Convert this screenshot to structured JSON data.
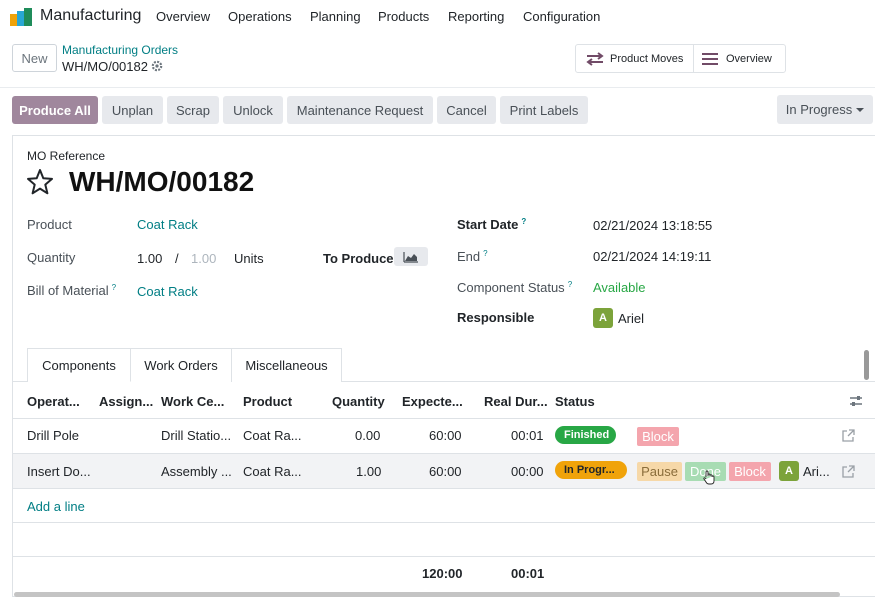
{
  "app": {
    "name": "Manufacturing",
    "menu": [
      "Overview",
      "Operations",
      "Planning",
      "Products",
      "Reporting",
      "Configuration"
    ]
  },
  "control": {
    "new_label": "New",
    "breadcrumb_parent": "Manufacturing Orders",
    "breadcrumb_current": "WH/MO/00182",
    "smart_buttons": [
      "Product Moves",
      "Overview"
    ]
  },
  "statusbar": {
    "buttons": [
      "Produce All",
      "Unplan",
      "Scrap",
      "Unlock",
      "Maintenance Request",
      "Cancel",
      "Print Labels"
    ],
    "state": "In Progress"
  },
  "form": {
    "reference_label": "MO Reference",
    "reference": "WH/MO/00182",
    "left_fields": {
      "product_label": "Product",
      "product": "Coat Rack",
      "quantity_label": "Quantity",
      "quantity": "1.00",
      "quantity_sep": "/",
      "quantity_to_produce": "1.00",
      "uom": "Units",
      "to_produce_label": "To Produce",
      "bom_label": "Bill of Material",
      "bom": "Coat Rack",
      "help_mark": "?"
    },
    "right_fields": {
      "start_label": "Start Date",
      "start": "02/21/2024 13:18:55",
      "end_label": "End",
      "end": "02/21/2024 14:19:11",
      "component_status_label": "Component Status",
      "component_status": "Available",
      "responsible_label": "Responsible",
      "responsible": "Ariel",
      "responsible_initial": "A"
    }
  },
  "tabs": [
    "Components",
    "Work Orders",
    "Miscellaneous"
  ],
  "work_orders": {
    "columns": [
      "Operat...",
      "Assign...",
      "Work Ce...",
      "Product",
      "Quantity",
      "Expecte...",
      "Real Dur...",
      "Status"
    ],
    "rows": [
      {
        "operation": "Drill Pole",
        "work_center": "Drill Statio...",
        "product": "Coat Ra...",
        "quantity": "0.00",
        "expected": "60:00",
        "real": "00:01",
        "status": "Finished",
        "actions": [
          "Block"
        ]
      },
      {
        "operation": "Insert Do...",
        "work_center": "Assembly ...",
        "product": "Coat Ra...",
        "quantity": "1.00",
        "expected": "60:00",
        "real": "00:00",
        "status": "In Progr...",
        "actions": [
          "Pause",
          "Done",
          "Block"
        ],
        "user_initial": "A",
        "user": "Ari..."
      }
    ],
    "add_line": "Add a line",
    "totals": {
      "expected": "120:00",
      "real": "00:01"
    }
  },
  "colors": {
    "primary": "#a0879d",
    "link": "#017e84",
    "finished": "#28a745",
    "in_progress": "#f0a30a"
  }
}
